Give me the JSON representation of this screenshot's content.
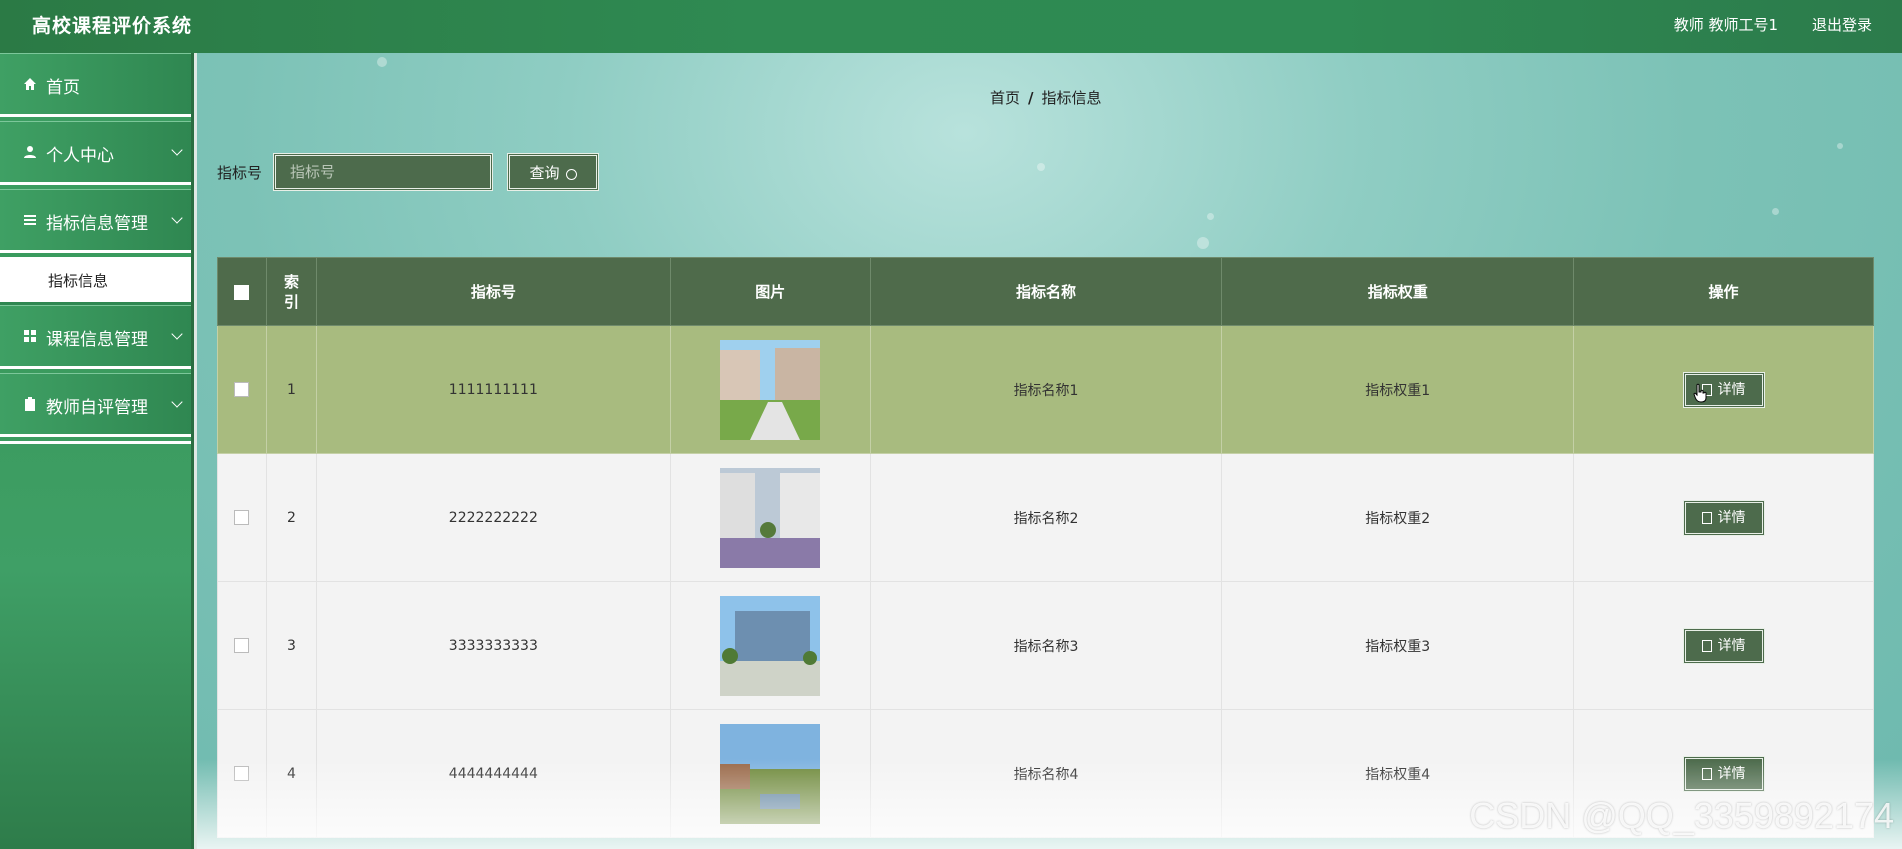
{
  "header": {
    "app_title": "高校课程评价系统",
    "user_info": "教师  教师工号1",
    "logout": "退出登录"
  },
  "sidebar": {
    "items": [
      {
        "label": "首页",
        "icon": "home-icon"
      },
      {
        "label": "个人中心",
        "icon": "user-icon"
      },
      {
        "label": "指标信息管理",
        "icon": "list-icon"
      },
      {
        "label": "课程信息管理",
        "icon": "grid-icon"
      },
      {
        "label": "教师自评管理",
        "icon": "clipboard-icon"
      }
    ],
    "active_sub": "指标信息"
  },
  "breadcrumb": {
    "home": "首页",
    "sep": "/",
    "current": "指标信息"
  },
  "search": {
    "label": "指标号",
    "placeholder": "指标号",
    "button": "查询"
  },
  "table": {
    "headers": [
      "索\n引",
      "指标号",
      "图片",
      "指标名称",
      "指标权重",
      "操作"
    ],
    "rows": [
      {
        "index": "1",
        "code": "1111111111",
        "name": "指标名称1",
        "weight": "指标权重1",
        "action": "详情"
      },
      {
        "index": "2",
        "code": "2222222222",
        "name": "指标名称2",
        "weight": "指标权重2",
        "action": "详情"
      },
      {
        "index": "3",
        "code": "3333333333",
        "name": "指标名称3",
        "weight": "指标权重3",
        "action": "详情"
      },
      {
        "index": "4",
        "code": "4444444444",
        "name": "指标名称4",
        "weight": "指标权重4",
        "action": "详情"
      }
    ]
  },
  "watermark": "CSDN @QQ_3359892174",
  "colors": {
    "header": "#2e8a53",
    "sidebar": "#3a9a5c",
    "button": "#4d6b4c",
    "table_header": "#4f6b4b",
    "row_highlight": "#a8bb7f"
  }
}
